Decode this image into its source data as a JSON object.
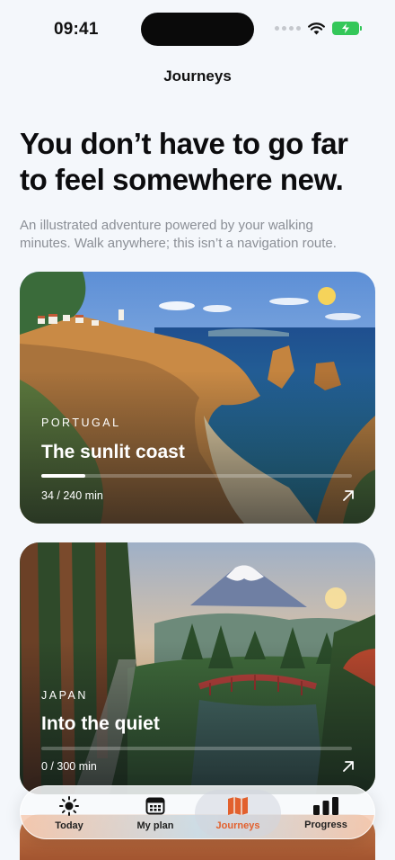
{
  "status": {
    "time": "09:41"
  },
  "nav": {
    "title": "Journeys"
  },
  "intro": {
    "headline": "You don’t have to go far to feel somewhere new.",
    "subtext": "An illustrated adventure powered by your walking minutes. Walk anywhere; this isn’t a navigation route."
  },
  "journeys": [
    {
      "region": "PORTUGAL",
      "title": "The sunlit coast",
      "progress_text": "34 / 240 min",
      "progress_fraction": 0.1417
    },
    {
      "region": "JAPAN",
      "title": "Into the quiet",
      "progress_text": "0 / 300 min",
      "progress_fraction": 0
    }
  ],
  "tabbar": {
    "items": [
      {
        "label": "Today",
        "icon": "sun-icon"
      },
      {
        "label": "My plan",
        "icon": "calendar-icon"
      },
      {
        "label": "Journeys",
        "icon": "map-icon",
        "active": true
      },
      {
        "label": "Progress",
        "icon": "bar-chart-icon"
      }
    ]
  },
  "colors": {
    "accent": "#e2602d",
    "background": "#f4f7fb",
    "battery": "#34c759"
  }
}
